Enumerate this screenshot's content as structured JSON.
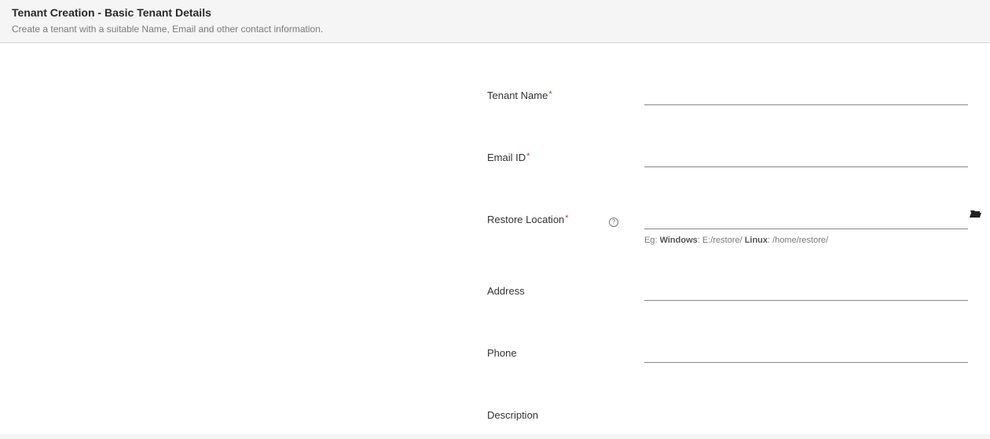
{
  "header": {
    "title": "Tenant Creation - Basic Tenant Details",
    "subtitle": "Create a tenant with a suitable Name, Email and other contact information."
  },
  "form": {
    "tenant_name": {
      "label": "Tenant Name",
      "value": ""
    },
    "email_id": {
      "label": "Email ID",
      "value": ""
    },
    "restore_location": {
      "label": "Restore Location",
      "value": "",
      "hint_prefix": "Eg: ",
      "hint_b1": "Windows",
      "hint_mid1": ": E:/restore/ ",
      "hint_b2": "Linux",
      "hint_mid2": ": /home/restore/"
    },
    "address": {
      "label": "Address",
      "value": ""
    },
    "phone": {
      "label": "Phone",
      "value": ""
    },
    "description": {
      "label": "Description",
      "value": ""
    }
  }
}
